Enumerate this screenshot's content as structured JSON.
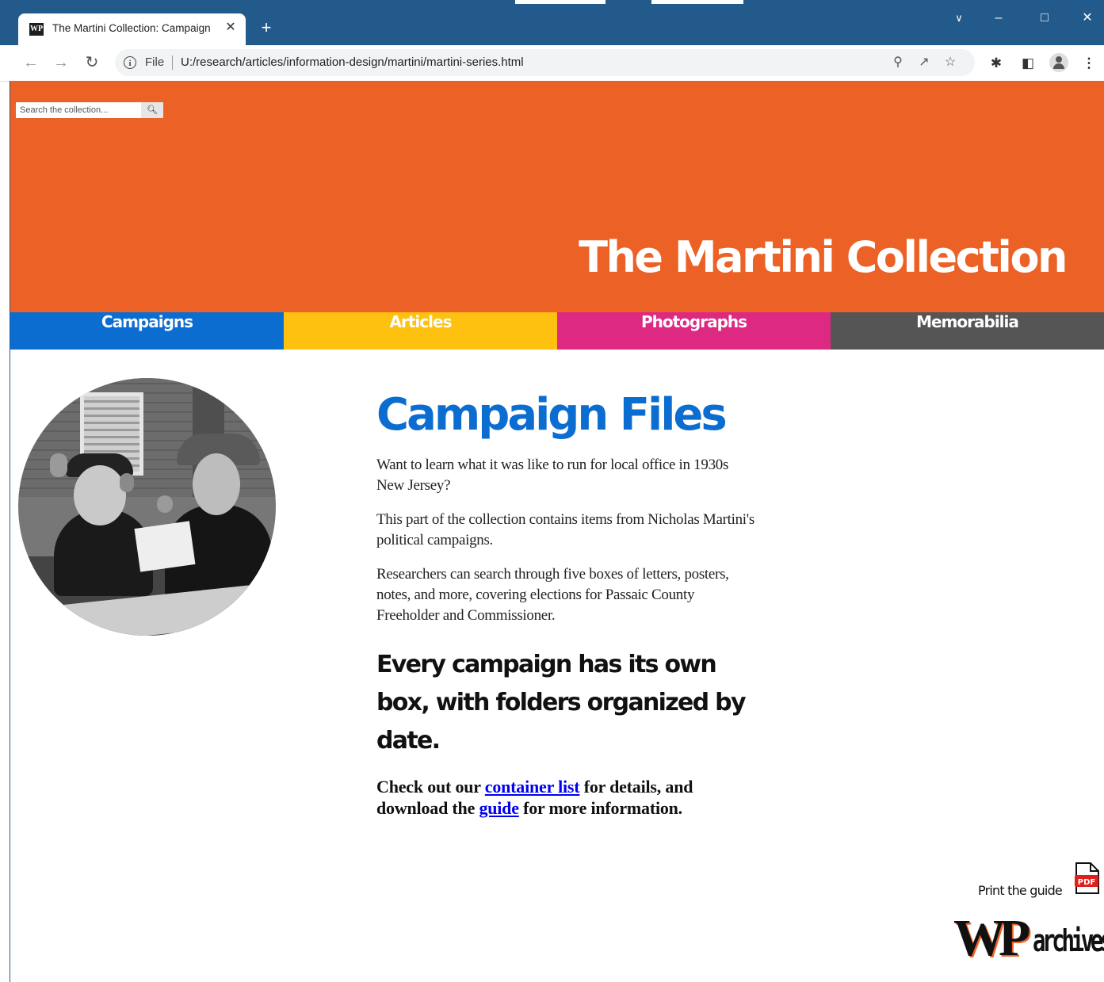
{
  "browser": {
    "tab_title": "The Martini Collection: Campaign",
    "favicon_text": "WP",
    "close_symbol": "✕",
    "new_tab_symbol": "+",
    "file_label": "File",
    "url": "U:/research/articles/information-design/martini/martini-series.html"
  },
  "header": {
    "search_placeholder": "Search the collection...",
    "title": "The Martini Collection"
  },
  "nav": [
    {
      "label": "Campaigns",
      "color": "#0c6dd1"
    },
    {
      "label": "Articles",
      "color": "#fec10f"
    },
    {
      "label": "Photographs",
      "color": "#dd2981"
    },
    {
      "label": "Memorabilia",
      "color": "#555555"
    }
  ],
  "main": {
    "title": "Campaign Files",
    "paragraphs": [
      "Want to learn what it was like to run for local office in 1930s New Jersey?",
      "This part of the collection contains items from Nicholas Martini's political campaigns.",
      "Researchers can search through five boxes of letters, posters, notes, and more, covering elections for Passaic County Freeholder and Commissioner."
    ],
    "subheading": "Every campaign has its own box, with folders organized by date.",
    "cta": {
      "before": "Check out our ",
      "link1": "container list",
      "middle": " for details, and download the ",
      "link2": "guide",
      "after": " for more information."
    }
  },
  "footer": {
    "print_guide": "Print the guide",
    "pdf_badge": "PDF",
    "logo_mark": "WP",
    "logo_word": "archives"
  },
  "colors": {
    "hero": "#ec6126",
    "title_blue": "#0c6dd1",
    "chrome_blue": "#235a8c"
  }
}
